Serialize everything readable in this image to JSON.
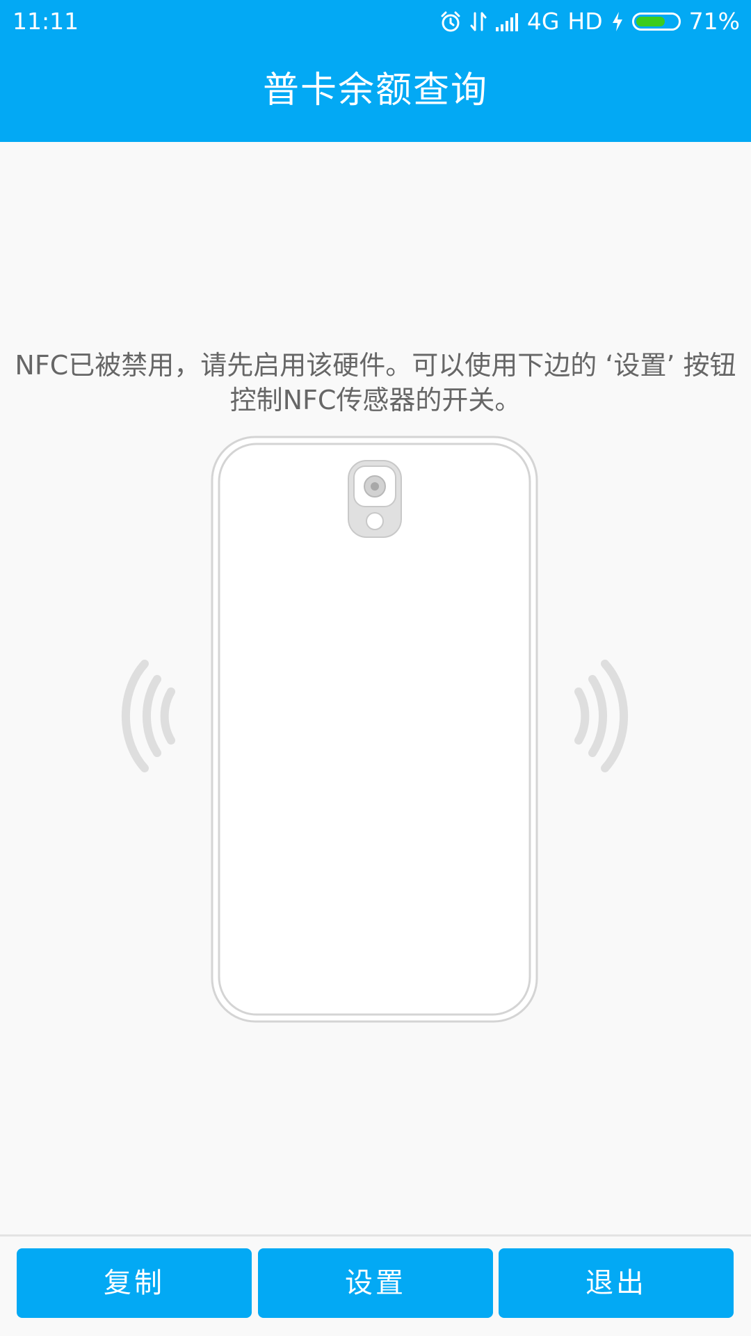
{
  "status_bar": {
    "time": "11:11",
    "network": "4G",
    "hd": "HD",
    "battery_percent_text": "71%",
    "battery_level": 0.71,
    "battery_color": "#3ccc1e",
    "icons": [
      "alarm-icon",
      "data-transfer-icon",
      "signal-icon",
      "charging-icon",
      "battery-icon"
    ]
  },
  "app_bar": {
    "title": "普卡余额查询",
    "color": "#03a9f4"
  },
  "main": {
    "message": "NFC已被禁用，请先启用该硬件。可以使用下边的 ‘设置’ 按钮控制NFC传感器的开关。",
    "illustration_icons": [
      "phone-outline-icon",
      "camera-icon",
      "nfc-wave-left-icon",
      "nfc-wave-right-icon"
    ]
  },
  "buttons": {
    "copy_label": "复制",
    "settings_label": "设置",
    "exit_label": "退出"
  }
}
